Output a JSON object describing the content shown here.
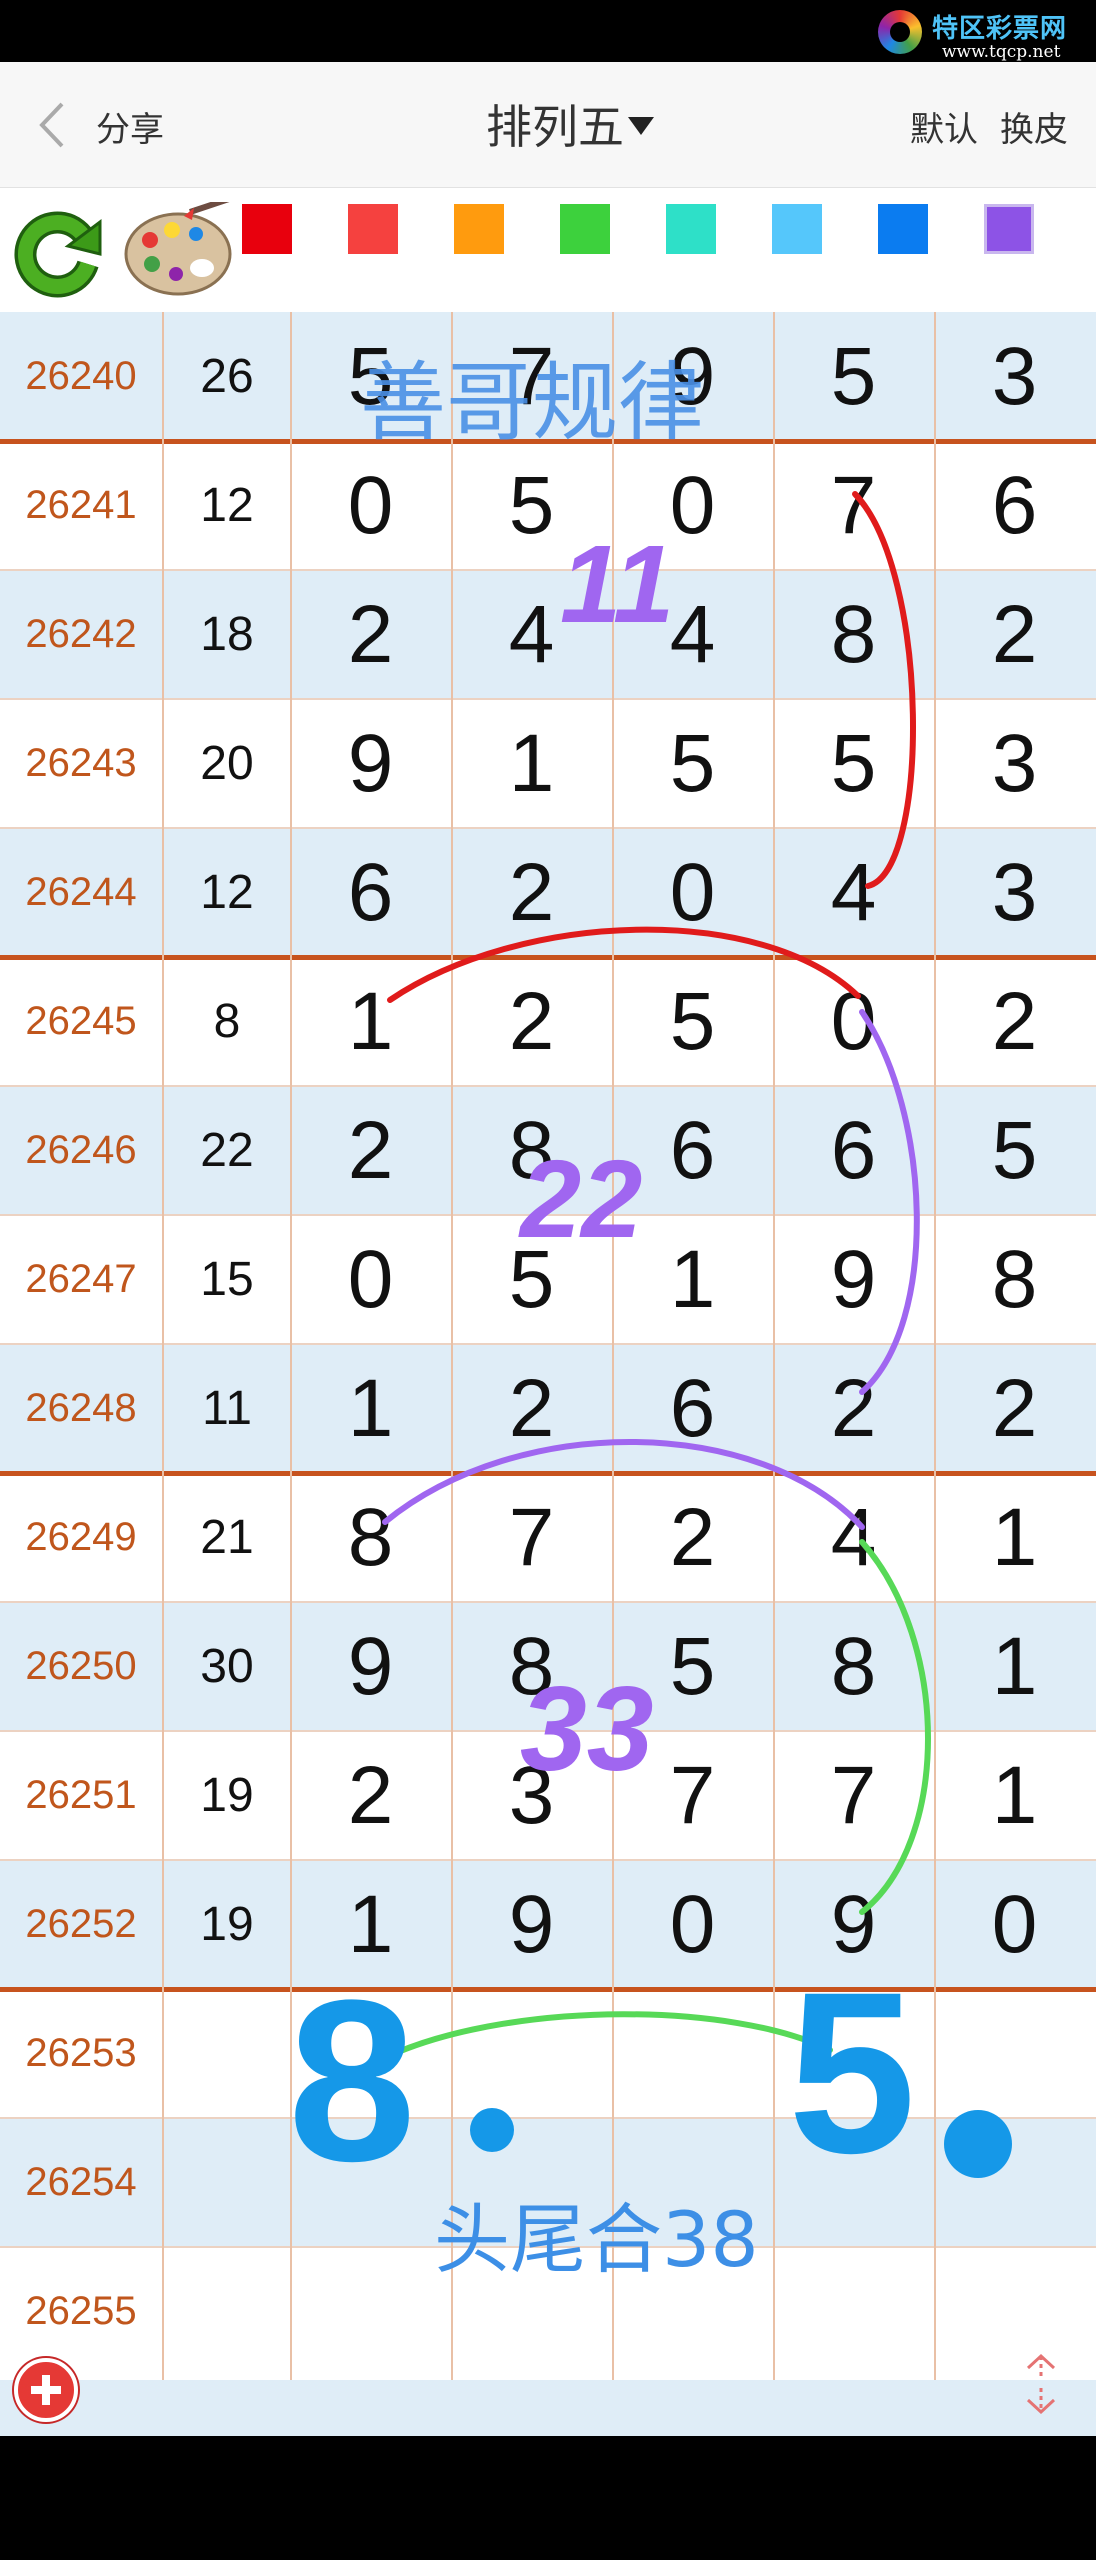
{
  "watermark": {
    "title": "特区彩票网",
    "url": "www.tqcp.net"
  },
  "header": {
    "share_label": "分享",
    "title": "排列五",
    "default_label": "默认",
    "skin_label": "换皮"
  },
  "toolbar": {
    "swatches": [
      "#e8000d",
      "#f5413f",
      "#ff9b0e",
      "#3dd13d",
      "#2ee0c8",
      "#55c7fb",
      "#0b7cf0",
      "#8d53e6"
    ]
  },
  "table": {
    "rows": [
      {
        "issue": "26240",
        "sum": "26",
        "digits": [
          "5",
          "7",
          "9",
          "5",
          "3"
        ]
      },
      {
        "issue": "26241",
        "sum": "12",
        "digits": [
          "0",
          "5",
          "0",
          "7",
          "6"
        ]
      },
      {
        "issue": "26242",
        "sum": "18",
        "digits": [
          "2",
          "4",
          "4",
          "8",
          "2"
        ]
      },
      {
        "issue": "26243",
        "sum": "20",
        "digits": [
          "9",
          "1",
          "5",
          "5",
          "3"
        ]
      },
      {
        "issue": "26244",
        "sum": "12",
        "digits": [
          "6",
          "2",
          "0",
          "4",
          "3"
        ]
      },
      {
        "issue": "26245",
        "sum": "8",
        "digits": [
          "1",
          "2",
          "5",
          "0",
          "2"
        ]
      },
      {
        "issue": "26246",
        "sum": "22",
        "digits": [
          "2",
          "8",
          "6",
          "6",
          "5"
        ]
      },
      {
        "issue": "26247",
        "sum": "15",
        "digits": [
          "0",
          "5",
          "1",
          "9",
          "8"
        ]
      },
      {
        "issue": "26248",
        "sum": "11",
        "digits": [
          "1",
          "2",
          "6",
          "2",
          "2"
        ]
      },
      {
        "issue": "26249",
        "sum": "21",
        "digits": [
          "8",
          "7",
          "2",
          "4",
          "1"
        ]
      },
      {
        "issue": "26250",
        "sum": "30",
        "digits": [
          "9",
          "8",
          "5",
          "8",
          "1"
        ]
      },
      {
        "issue": "26251",
        "sum": "19",
        "digits": [
          "2",
          "3",
          "7",
          "7",
          "1"
        ]
      },
      {
        "issue": "26252",
        "sum": "19",
        "digits": [
          "1",
          "9",
          "0",
          "9",
          "0"
        ]
      },
      {
        "issue": "26253",
        "sum": "",
        "digits": [
          "",
          "",
          "",
          "",
          ""
        ]
      },
      {
        "issue": "26254",
        "sum": "",
        "digits": [
          "",
          "",
          "",
          "",
          ""
        ]
      },
      {
        "issue": "26255",
        "sum": "",
        "digits": [
          "",
          "",
          "",
          "",
          ""
        ]
      }
    ]
  },
  "annotations": {
    "title": "善哥规律",
    "mark1": "11",
    "mark2": "22",
    "mark3": "33",
    "prediction_head": "8",
    "prediction_tail": "5",
    "combo": "头尾合38"
  },
  "colors": {
    "issue_text": "#c0561c",
    "group_line": "#c7531e",
    "alt_row": "#dfedf7"
  }
}
